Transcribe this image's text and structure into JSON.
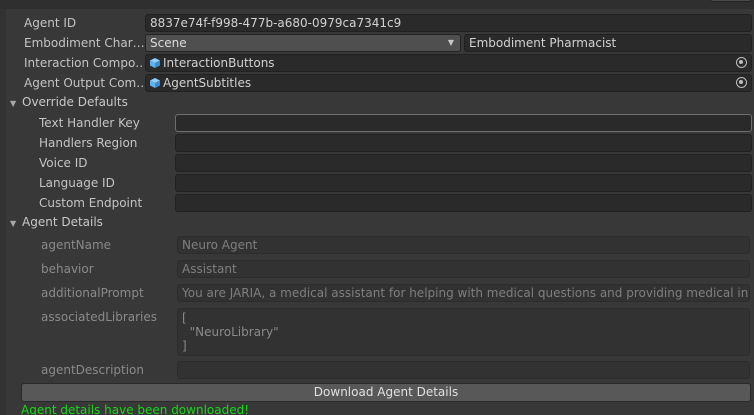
{
  "fields": {
    "agent_id": {
      "label": "Agent ID",
      "value": "8837e74f-f998-477b-a680-0979ca7341c9"
    },
    "embodiment": {
      "label": "Embodiment Char…",
      "selected": "Scene",
      "name": "Embodiment Pharmacist"
    },
    "interaction": {
      "label": "Interaction Compo…",
      "value": "InteractionButtons"
    },
    "agent_output": {
      "label": "Agent Output Com…",
      "value": "AgentSubtitles"
    }
  },
  "override": {
    "title": "Override Defaults",
    "text_handler_key": {
      "label": "Text Handler Key",
      "value": ""
    },
    "handlers_region": {
      "label": "Handlers Region",
      "value": ""
    },
    "voice_id": {
      "label": "Voice ID",
      "value": ""
    },
    "language_id": {
      "label": "Language ID",
      "value": ""
    },
    "custom_endpoint": {
      "label": "Custom Endpoint",
      "value": ""
    }
  },
  "details": {
    "title": "Agent Details",
    "agent_name": {
      "label": "agentName",
      "value": "Neuro Agent"
    },
    "behavior": {
      "label": "behavior",
      "value": "Assistant"
    },
    "additional_prompt": {
      "label": "additionalPrompt",
      "value": "You are JARIA, a medical assistant for helping with medical questions and providing medical information"
    },
    "associated_libraries": {
      "label": "associatedLibraries",
      "value": "[\n  \"NeuroLibrary\"\n]"
    },
    "agent_description": {
      "label": "agentDescription",
      "value": ""
    }
  },
  "download_button": "Download Agent Details",
  "status_message": "Agent details have been downloaded!",
  "colors": {
    "status": "#18d818",
    "component_icon": "#5fb3f0"
  }
}
